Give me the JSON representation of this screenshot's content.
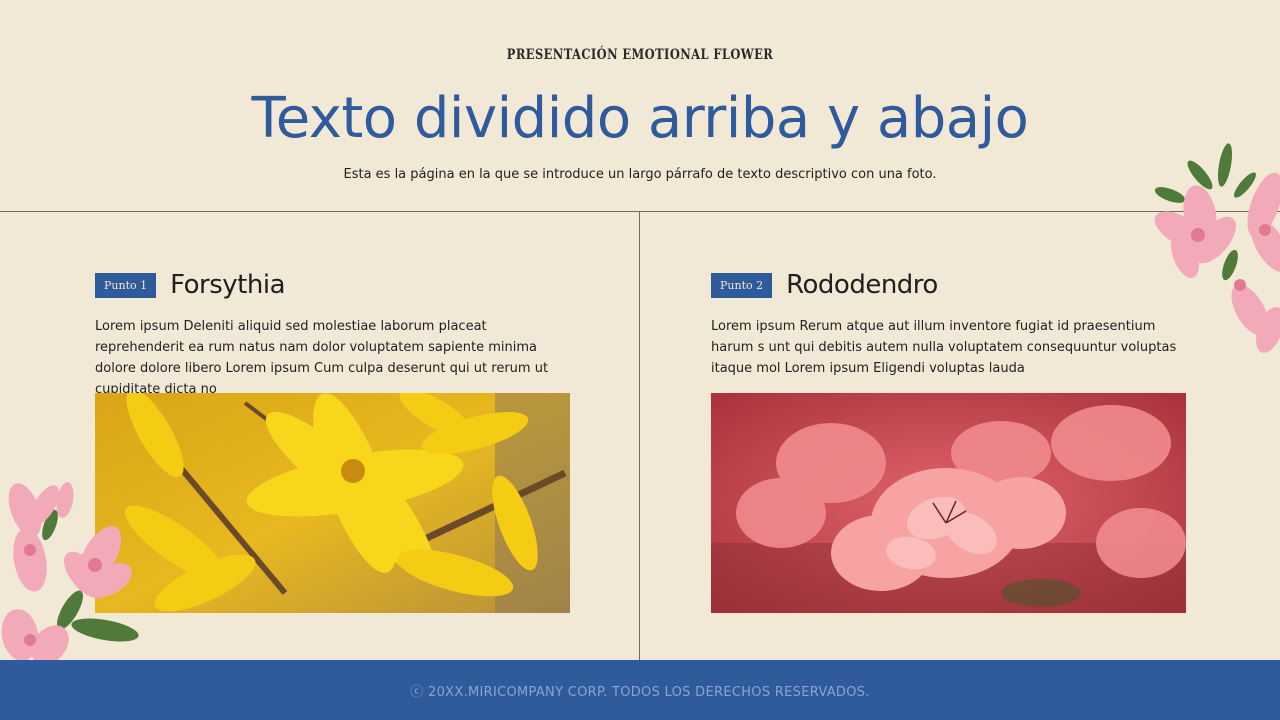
{
  "header": {
    "kicker": "PRESENTACIÓN EMOTIONAL FLOWER",
    "title": "Texto dividido arriba y abajo",
    "subtitle": "Esta es la página en la que se introduce un largo párrafo de texto descriptivo con una foto."
  },
  "columns": [
    {
      "badge": "Punto 1",
      "title": "Forsythia",
      "text": "Lorem ipsum Deleniti aliquid sed molestiae laborum placeat reprehenderit ea rum natus nam dolor voluptatem sapiente minima dolore dolore libero Lorem ipsum Cum culpa deserunt qui ut rerum ut cupiditate dicta no",
      "photo_color": "#f2c414"
    },
    {
      "badge": "Punto 2",
      "title": "Rododendro",
      "text": "Lorem ipsum Rerum atque aut illum inventore fugiat id praesentium harum s unt qui debitis autem nulla voluptatem consequuntur voluptas itaque mol Lorem ipsum Eligendi voluptas lauda",
      "photo_color": "#e0606a"
    }
  ],
  "footer": {
    "text": "ⓒ 20XX.MIRICOMPANY CORP. TODOS LOS DERECHOS RESERVADOS."
  },
  "colors": {
    "background": "#f1e8d6",
    "accent": "#2f5a9b"
  }
}
